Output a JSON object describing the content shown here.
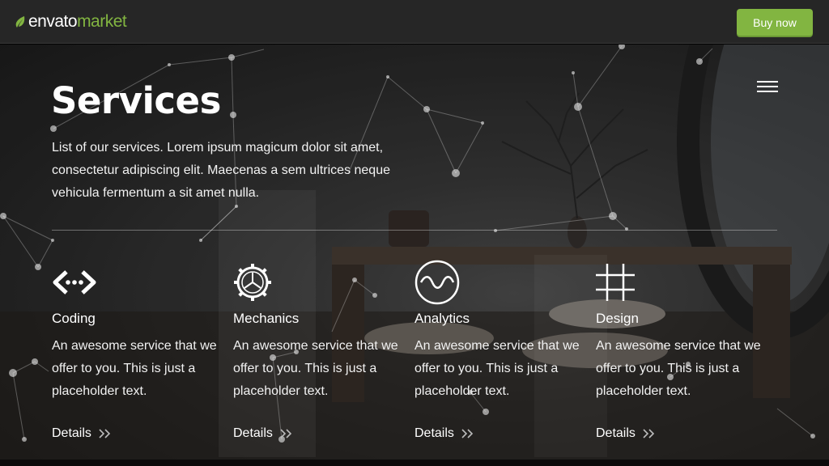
{
  "header": {
    "logo_envato": "envato",
    "logo_market": "market",
    "buy_label": "Buy now",
    "accent_color": "#82b541"
  },
  "hero": {
    "title": "Services",
    "intro": "List of our services. Lorem ipsum magicum dolor sit amet, consectetur adipiscing elit. Maecenas a sem ultrices neque vehicula fermentum a sit amet nulla."
  },
  "services": [
    {
      "icon": "code-icon",
      "name": "Coding",
      "description": "An awesome service that we offer to you. This is just a placeholder text.",
      "details_label": "Details"
    },
    {
      "icon": "gear-icon",
      "name": "Mechanics",
      "description": "An awesome service that we offer to you. This is just a placeholder text.",
      "details_label": "Details"
    },
    {
      "icon": "wave-circle-icon",
      "name": "Analytics",
      "description": "An awesome service that we offer to you. This is just a placeholder text.",
      "details_label": "Details"
    },
    {
      "icon": "grid-hash-icon",
      "name": "Design",
      "description": "An awesome service that we offer to you. This is just a placeholder text.",
      "details_label": "Details"
    }
  ]
}
